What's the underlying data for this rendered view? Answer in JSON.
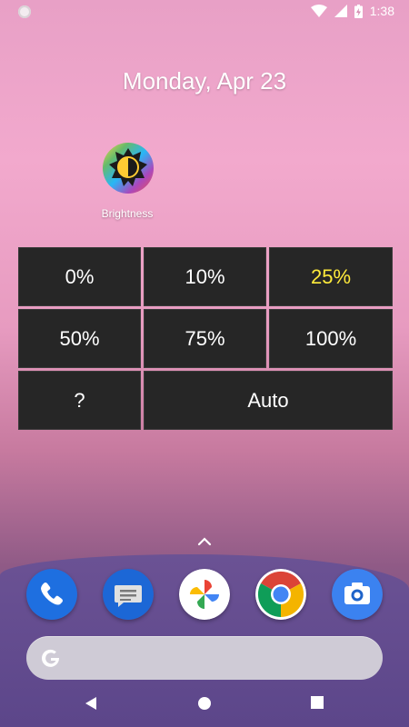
{
  "status_bar": {
    "time": "1:38"
  },
  "home": {
    "date": "Monday, Apr 23"
  },
  "app": {
    "label": "Brightness"
  },
  "brightness_widget": {
    "options": [
      "0%",
      "10%",
      "25%",
      "50%",
      "75%",
      "100%",
      "?",
      "Auto"
    ],
    "selected": "25%",
    "selected_color": "#ffeb3b"
  },
  "dock": {
    "apps": [
      "Phone",
      "Messages",
      "Photos",
      "Chrome",
      "Camera"
    ]
  },
  "nav": {
    "buttons": [
      "back",
      "home",
      "recents"
    ]
  }
}
